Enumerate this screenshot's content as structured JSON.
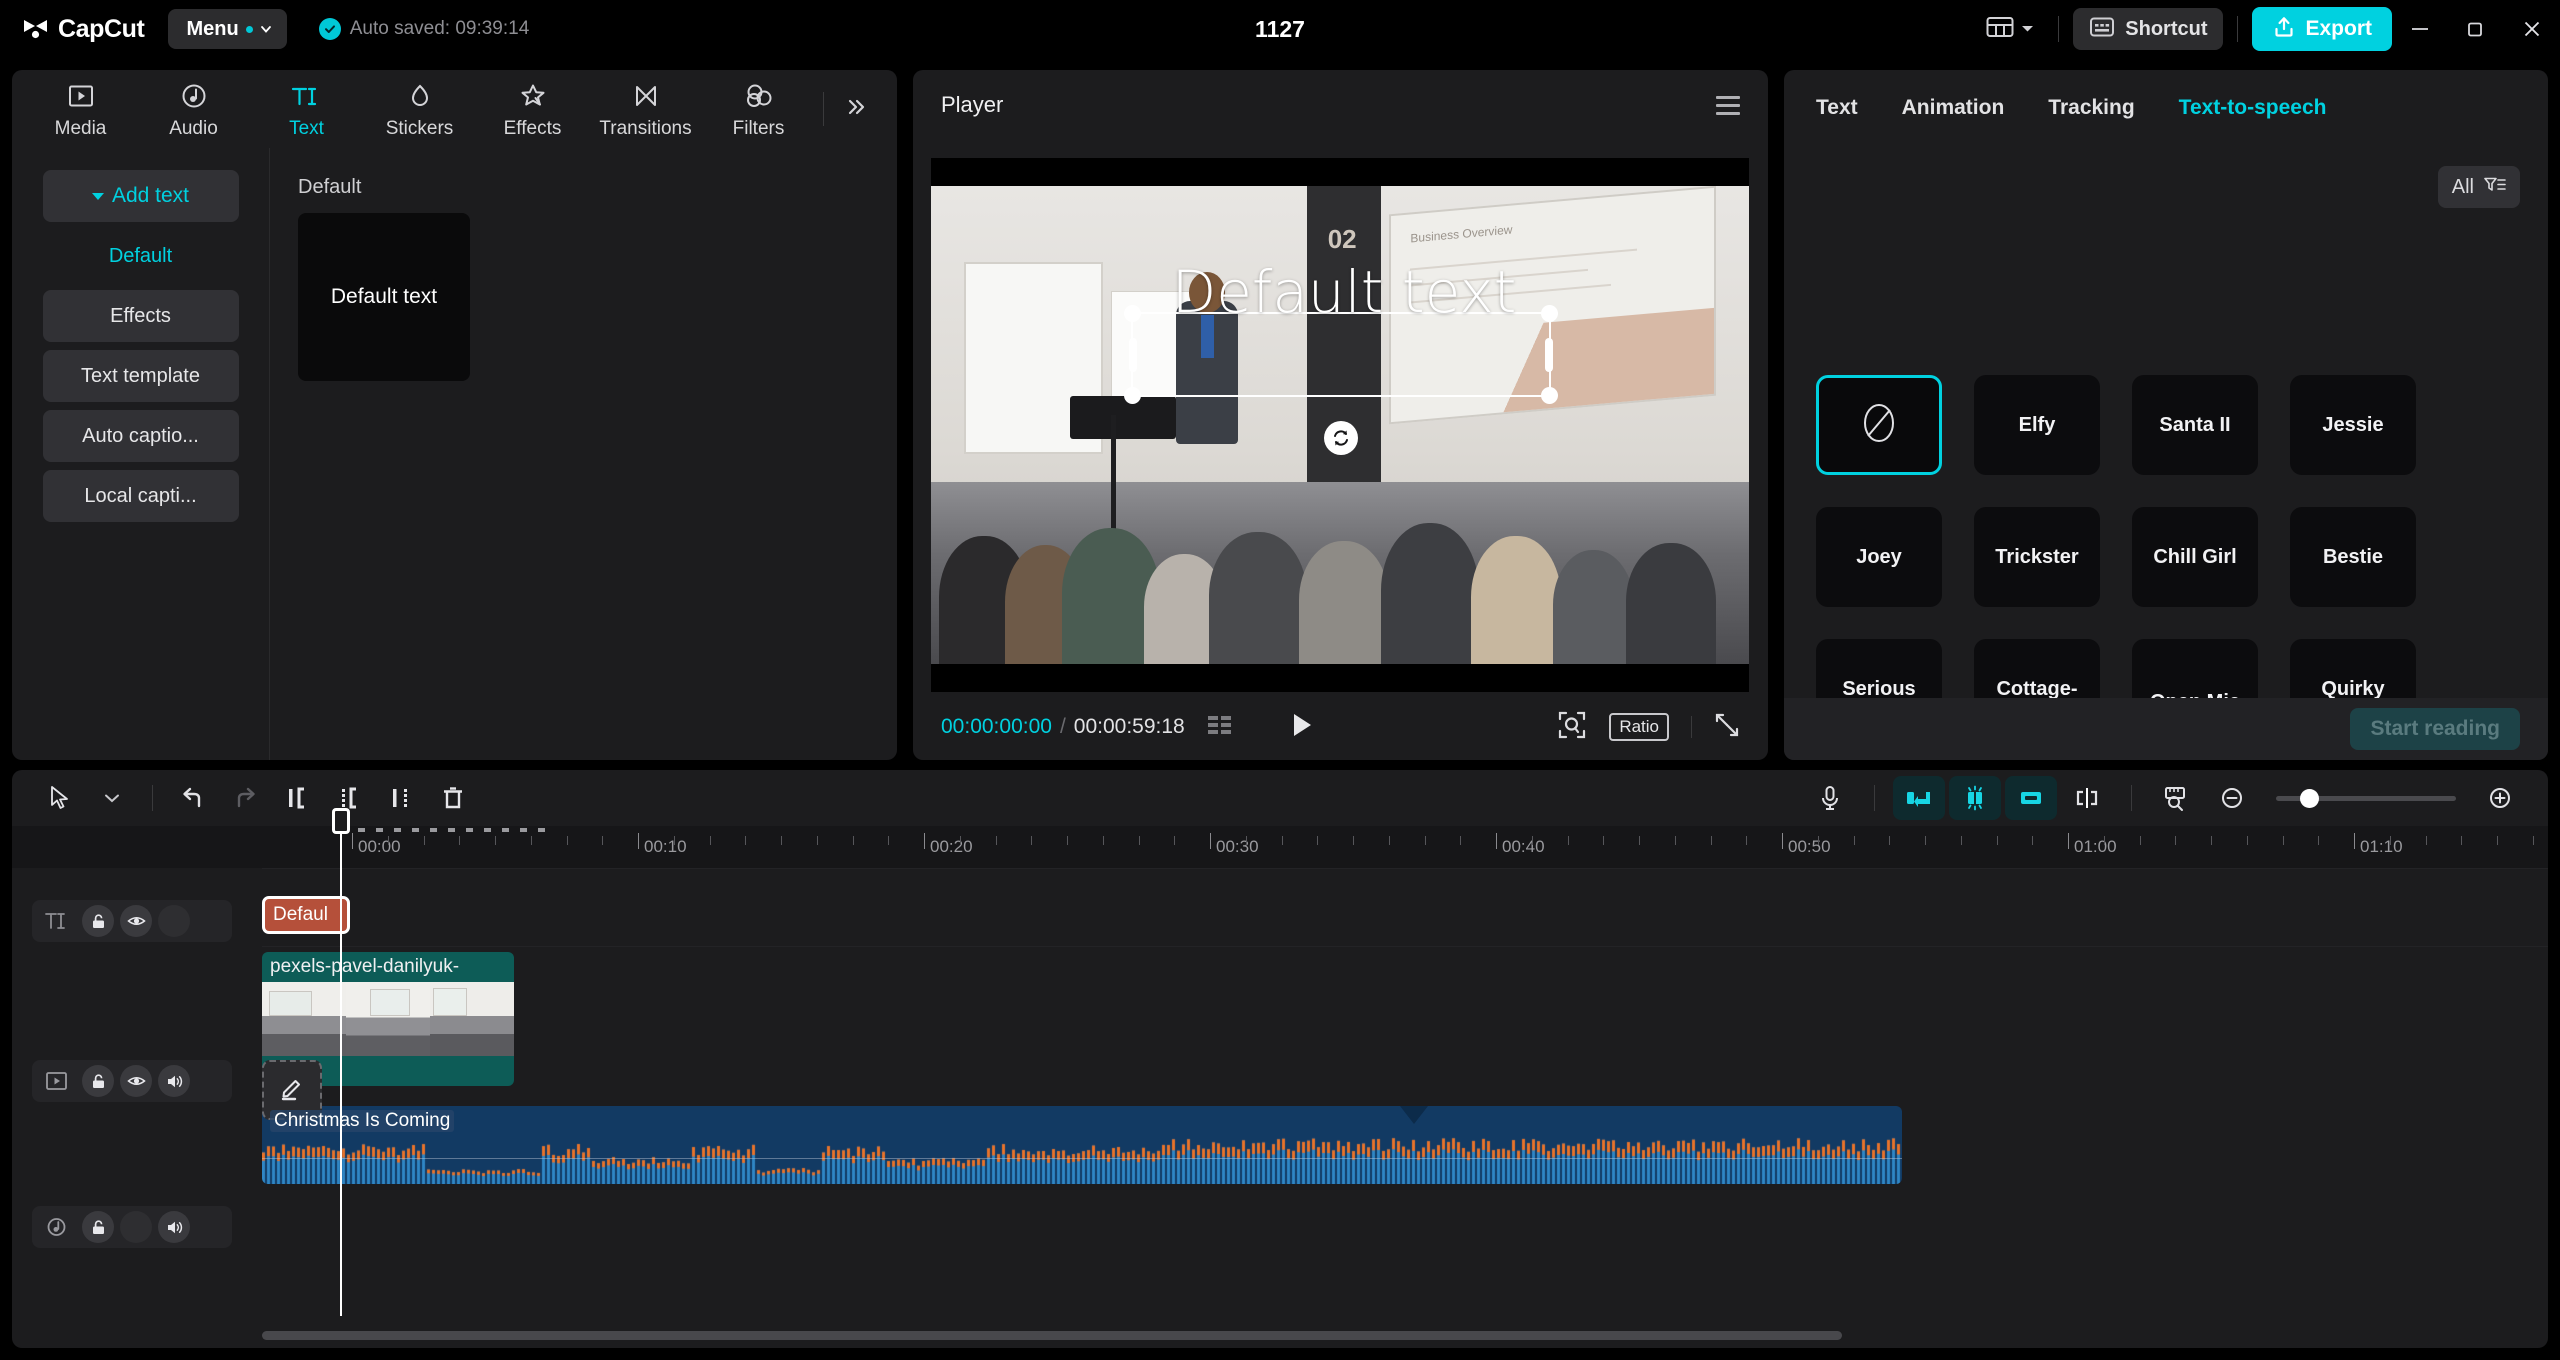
{
  "titlebar": {
    "app_name": "CapCut",
    "menu_label": "Menu",
    "autosave_text": "Auto saved: 09:39:14",
    "project_title": "1127",
    "shortcut_label": "Shortcut",
    "export_label": "Export",
    "accent_color": "#00d1e0",
    "icons": {
      "logo": "capcut-logo-icon",
      "menu_chevron": "chevron-down-icon",
      "autosave_check": "check-circle-icon",
      "layout": "layout-grid-icon",
      "layout_chevron": "chevron-down-icon",
      "shortcut": "keyboard-icon",
      "export": "upload-icon",
      "minimize": "minimize-icon",
      "maximize": "restore-window-icon",
      "close": "close-icon"
    }
  },
  "left_panel": {
    "tabs": [
      {
        "label": "Media",
        "icon": "media-play-box-icon",
        "active": false
      },
      {
        "label": "Audio",
        "icon": "audio-note-icon",
        "active": false
      },
      {
        "label": "Text",
        "icon": "text-ti-icon",
        "active": true
      },
      {
        "label": "Stickers",
        "icon": "sticker-drop-icon",
        "active": false
      },
      {
        "label": "Effects",
        "icon": "effects-star-icon",
        "active": false
      },
      {
        "label": "Transitions",
        "icon": "transitions-bowtie-icon",
        "active": false
      },
      {
        "label": "Filters",
        "icon": "filters-rings-icon",
        "active": false
      }
    ],
    "more_tabs_icon": "double-chevron-right-icon",
    "sidebar": [
      {
        "label": "Add text",
        "kind": "addtext",
        "active": true
      },
      {
        "label": "Default",
        "kind": "plain",
        "active": true
      },
      {
        "label": "Effects",
        "kind": "normal",
        "active": false
      },
      {
        "label": "Text template",
        "kind": "normal",
        "active": false
      },
      {
        "label": "Auto captio...",
        "kind": "normal",
        "active": false
      },
      {
        "label": "Local capti...",
        "kind": "normal",
        "active": false
      }
    ],
    "content_heading": "Default",
    "preset_card_text": "Default text"
  },
  "player": {
    "title": "Player",
    "menu_icon": "hamburger-menu-icon",
    "overlay_text": "Default text",
    "current_time": "00:00:00:00",
    "time_separator": "/",
    "total_time": "00:00:59:18",
    "grid_icon": "frames-grid-icon",
    "play_icon": "play-icon",
    "zoom_fit_icon": "fit-to-screen-icon",
    "ratio_label": "Ratio",
    "fullscreen_icon": "fullscreen-icon",
    "rotate_icon": "rotate-handle-icon"
  },
  "right_panel": {
    "tabs": [
      {
        "label": "Text",
        "active": false
      },
      {
        "label": "Animation",
        "active": false
      },
      {
        "label": "Tracking",
        "active": false
      },
      {
        "label": "Text-to-speech",
        "active": true
      }
    ],
    "filter_label": "All",
    "filter_icon": "filter-sort-icon",
    "voices": [
      {
        "name": "",
        "icon": "none-slash-circle-icon",
        "selected": true
      },
      {
        "name": "Elfy",
        "selected": false
      },
      {
        "name": "Santa II",
        "selected": false
      },
      {
        "name": "Jessie",
        "selected": false
      },
      {
        "name": "Joey",
        "selected": false
      },
      {
        "name": "Trickster",
        "selected": false
      },
      {
        "name": "Chill Girl",
        "selected": false
      },
      {
        "name": "Bestie",
        "selected": false
      },
      {
        "name": "Serious",
        "selected": false
      },
      {
        "name": "Cottage-",
        "selected": false
      },
      {
        "name": "Open Mic",
        "selected": false
      },
      {
        "name": "Quirky",
        "selected": false
      }
    ],
    "start_reading_label": "Start reading"
  },
  "timeline": {
    "tools_left": [
      {
        "icon": "select-arrow-icon",
        "name": "select-tool"
      },
      {
        "icon": "chevron-down-icon",
        "name": "select-tool-dropdown"
      },
      {
        "icon": "undo-icon",
        "name": "undo-button"
      },
      {
        "icon": "redo-icon",
        "name": "redo-button"
      },
      {
        "icon": "split-icon",
        "name": "split-button"
      },
      {
        "icon": "trim-left-icon",
        "name": "trim-left-button"
      },
      {
        "icon": "trim-right-icon",
        "name": "trim-right-button"
      },
      {
        "icon": "delete-trash-icon",
        "name": "delete-button"
      }
    ],
    "tools_right": [
      {
        "icon": "microphone-icon",
        "name": "record-voiceover-button",
        "on": false
      },
      {
        "icon": "mirror-left-icon",
        "name": "reverse-button",
        "on": true
      },
      {
        "icon": "freeze-frame-icon",
        "name": "freeze-button",
        "on": true
      },
      {
        "icon": "mirror-right-icon",
        "name": "mirror-button",
        "on": true
      },
      {
        "icon": "snap-icon",
        "name": "snap-toggle",
        "on": false
      },
      {
        "icon": "ruler-zoom-icon",
        "name": "fit-timeline-button",
        "on": false
      }
    ],
    "zoom_out_icon": "zoom-out-icon",
    "zoom_in_icon": "zoom-in-icon",
    "ruler_labels": [
      "00:00",
      "00:10",
      "00:20",
      "00:30",
      "00:40",
      "00:50",
      "01:00",
      "01:10"
    ],
    "tracks": [
      {
        "kind_icon": "text-ti-icon",
        "name": "text-track",
        "lock": true,
        "eye": true,
        "volume": false
      },
      {
        "kind_icon": "video-box-icon",
        "name": "video-track",
        "lock": true,
        "eye": true,
        "volume": true
      },
      {
        "kind_icon": "audio-note-icon",
        "name": "audio-track",
        "lock": true,
        "eye": false,
        "volume": true
      }
    ],
    "edit_float_icon": "edit-pencil-icon",
    "clips": {
      "text_clip": "Defaul",
      "video_clip": "pexels-pavel-danilyuk-",
      "audio_clip": "Christmas Is Coming"
    },
    "colors": {
      "text_clip": "#b5503a",
      "video_clip": "#0d5c57",
      "audio_clip": "#123a63",
      "wave_low": "#2f86c5",
      "wave_peak": "#e8732a"
    }
  }
}
